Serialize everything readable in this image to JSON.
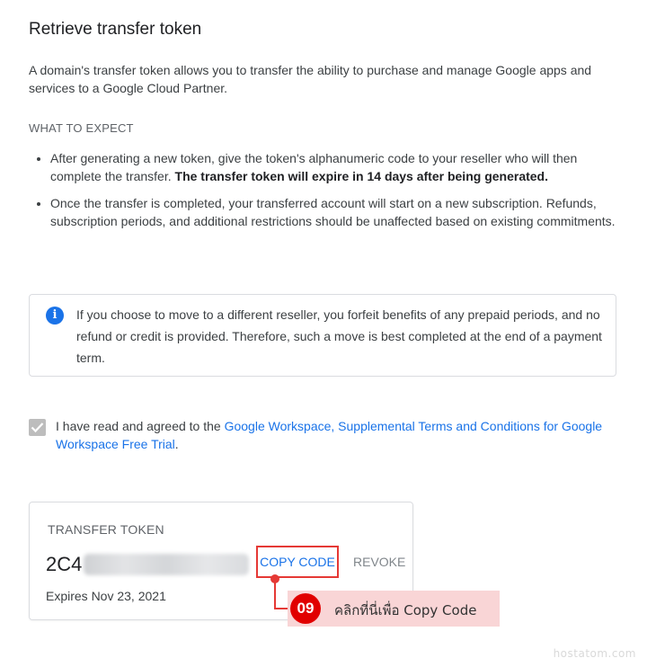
{
  "page": {
    "title": "Retrieve transfer token",
    "intro": "A domain's transfer token allows you to transfer the ability to purchase and manage Google apps and services to a Google Cloud Partner.",
    "what_to_expect_label": "WHAT TO EXPECT",
    "bullet1_normal": "After generating a new token, give the token's alphanumeric code to your reseller who will then complete the transfer. ",
    "bullet1_bold": "The transfer token will expire in 14 days after being generated.",
    "bullet2": "Once the transfer is completed, your transferred account will start on a new subscription. Refunds, subscription periods, and additional restrictions should be unaffected based on existing commitments."
  },
  "info_box": {
    "icon": "info-icon",
    "text": "If you choose to move to a different reseller, you forfeit benefits of any prepaid periods, and no refund or credit is provided. Therefore, such a move is best completed at the end of a payment term."
  },
  "agreement": {
    "checked": true,
    "text_prefix": "I have read and agreed to the ",
    "link_text": "Google Workspace, Supplemental Terms and Conditions for Google Workspace Free Trial",
    "text_suffix": "."
  },
  "token_card": {
    "label": "TRANSFER TOKEN",
    "code_visible": "2C4",
    "copy_button": "COPY CODE",
    "revoke_button": "REVOKE",
    "expires": "Expires Nov 23, 2021"
  },
  "annotation": {
    "step_number": "09",
    "text": "คลิกที่นี่เพื่อ Copy Code",
    "color": "#e10000"
  },
  "watermark": "hostatom.com",
  "colors": {
    "link": "#1a73e8",
    "highlight_border": "#e53935",
    "callout_bg": "#f9d5d6"
  }
}
